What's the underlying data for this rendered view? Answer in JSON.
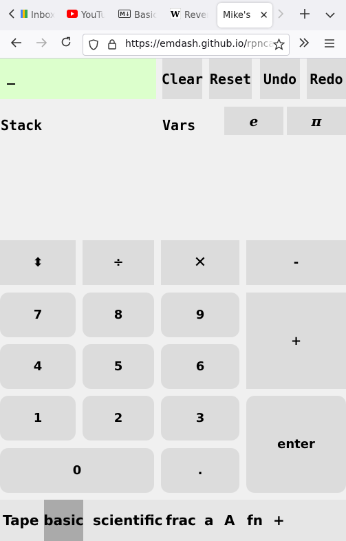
{
  "browser": {
    "tabs": [
      {
        "title": "Inbox",
        "icon": "gmail-icon",
        "active": false
      },
      {
        "title": "YouTu",
        "icon": "youtube-icon",
        "active": false
      },
      {
        "title": "Basic",
        "icon": "markdown-icon",
        "active": false
      },
      {
        "title": "Rever",
        "icon": "wikipedia-icon",
        "active": false
      },
      {
        "title": "Mike's",
        "icon": "",
        "active": true
      }
    ],
    "url_main": "https://emdash.github.io/",
    "url_rest": "rpncalc"
  },
  "calc": {
    "entry": "_",
    "buttons": {
      "clear": "Clear",
      "reset": "Reset",
      "undo": "Undo",
      "redo": "Redo"
    },
    "stack_label": "Stack",
    "vars_label": "Vars",
    "constants": {
      "e": "e",
      "pi": "π"
    },
    "keys": {
      "swap": "⬍",
      "divide": "÷",
      "multiply": "✕",
      "minus": "-",
      "seven": "7",
      "eight": "8",
      "nine": "9",
      "plus": "+",
      "four": "4",
      "five": "5",
      "six": "6",
      "one": "1",
      "two": "2",
      "three": "3",
      "enter": "enter",
      "zero": "0",
      "dot": "."
    },
    "modes": {
      "tape": "Tape",
      "basic": "basic",
      "scientific": "scientific",
      "frac": "frac",
      "a": "a",
      "A": "A",
      "fn": "fn",
      "plus": "+"
    },
    "active_mode": "basic"
  }
}
